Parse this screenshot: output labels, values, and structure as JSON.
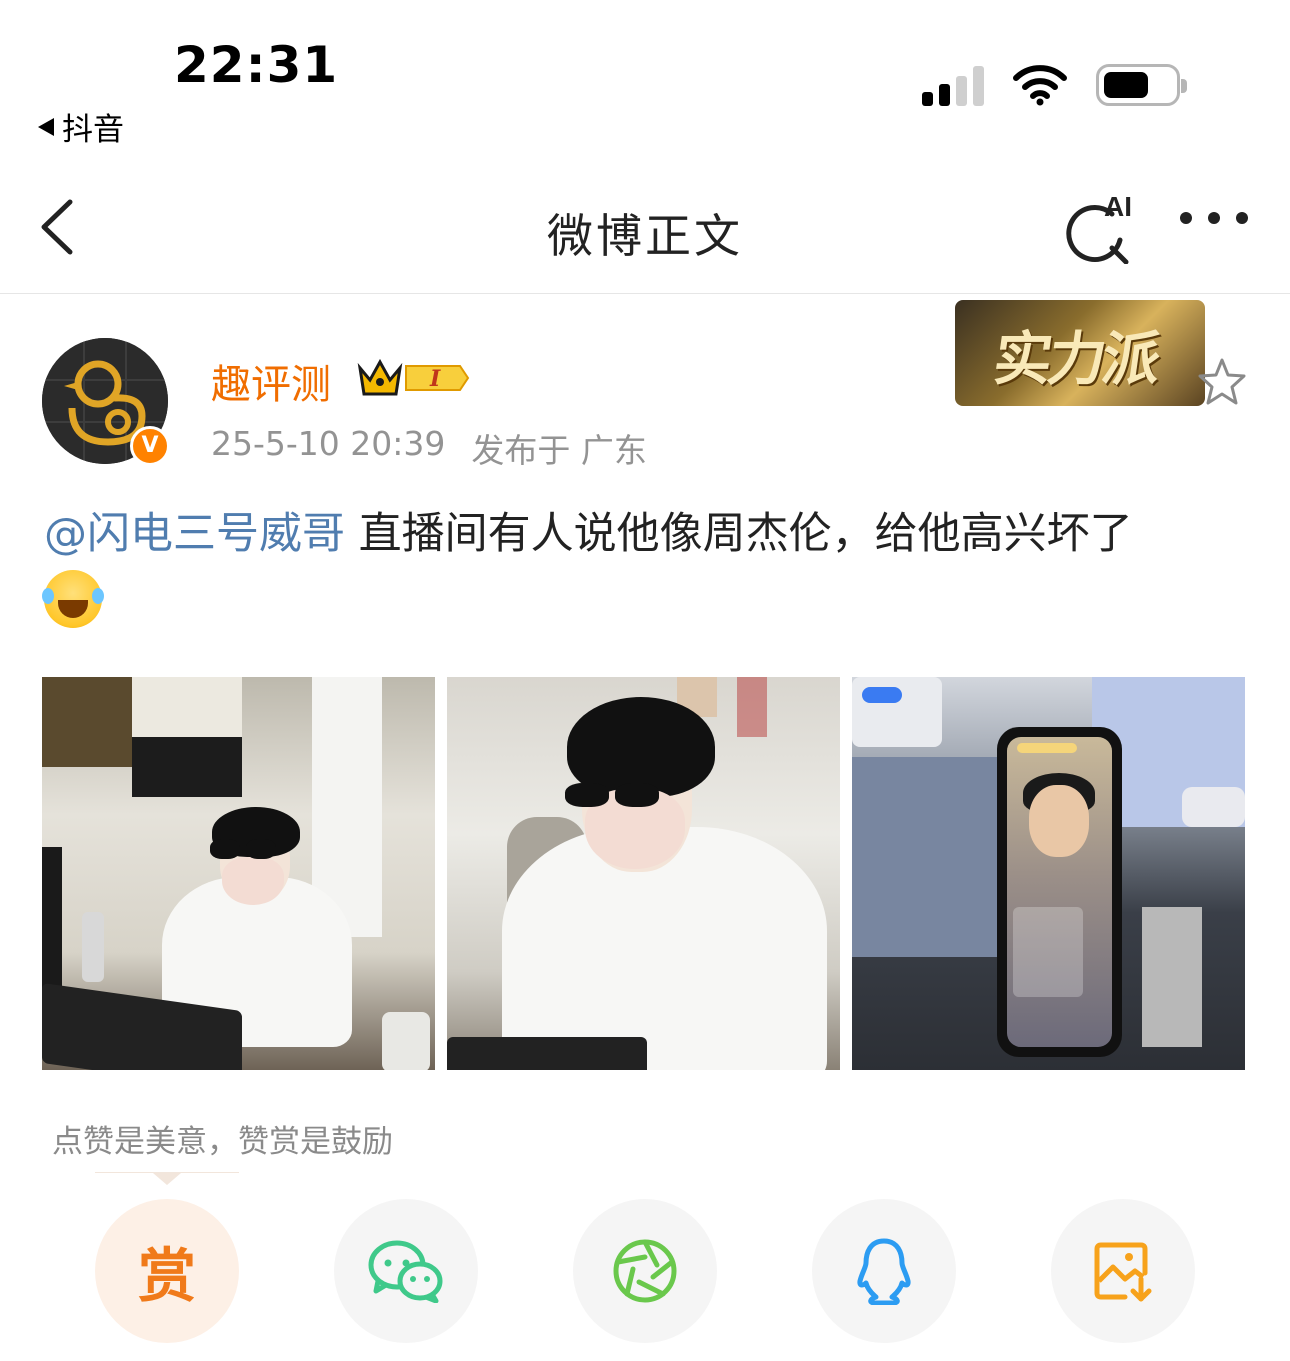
{
  "status_bar": {
    "time": "22:31",
    "back_app": "抖音"
  },
  "nav": {
    "title": "微博正文",
    "ai_label": "AI"
  },
  "post": {
    "author": "趣评测",
    "level_badge": "I",
    "timestamp": "25-5-10 20:39",
    "location": "发布于 广东",
    "decoration_text": "实力派",
    "mention": "@闪电三号威哥",
    "text": " 直播间有人说他像周杰伦，给他高兴坏了",
    "emoji": "laughing-tears",
    "images": [
      {
        "name": "photo-1"
      },
      {
        "name": "photo-2"
      },
      {
        "name": "photo-3"
      }
    ]
  },
  "reward": {
    "hint": "点赞是美意，赞赏是鼓励",
    "reward_label": "赏"
  },
  "share_targets": [
    "reward",
    "wechat",
    "moments",
    "qq",
    "save-image"
  ],
  "colors": {
    "author": "#f06d00",
    "mention": "#507daf",
    "wechat": "#3fc98a",
    "moments": "#6ac84c",
    "qq": "#2c9cf2",
    "save": "#f7a21b",
    "reward": "#f07a1a"
  }
}
